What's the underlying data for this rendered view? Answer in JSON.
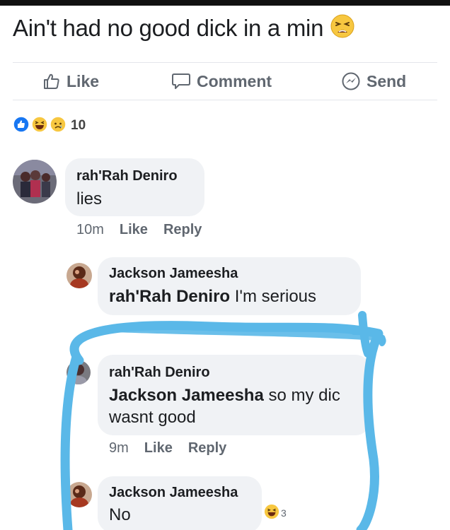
{
  "post": {
    "text": "Ain't had no good dick in a min",
    "emoji_icon": "tired-face-emoji"
  },
  "actions": {
    "like": "Like",
    "comment": "Comment",
    "send": "Send"
  },
  "reactions": {
    "icons": [
      "like-reaction-icon",
      "haha-reaction-icon",
      "sad-reaction-icon"
    ],
    "count": "10"
  },
  "comments": [
    {
      "author": "rah'Rah Deniro",
      "text": "lies",
      "time": "10m",
      "like": "Like",
      "reply": "Reply"
    },
    {
      "author": "Jackson Jameesha",
      "mention": "rah'Rah Deniro",
      "text": " I'm serious"
    },
    {
      "author": "rah'Rah Deniro",
      "mention": "Jackson Jameesha",
      "text_line1": " so my dic",
      "text_line2": "wasnt good",
      "time": "9m",
      "like": "Like",
      "reply": "Reply"
    },
    {
      "author": "Jackson Jameesha",
      "text": "No",
      "reaction_count": "3"
    }
  ],
  "colors": {
    "scribble": "#5ab8e8",
    "bubble": "#f0f2f5",
    "meta_text": "#606770"
  }
}
